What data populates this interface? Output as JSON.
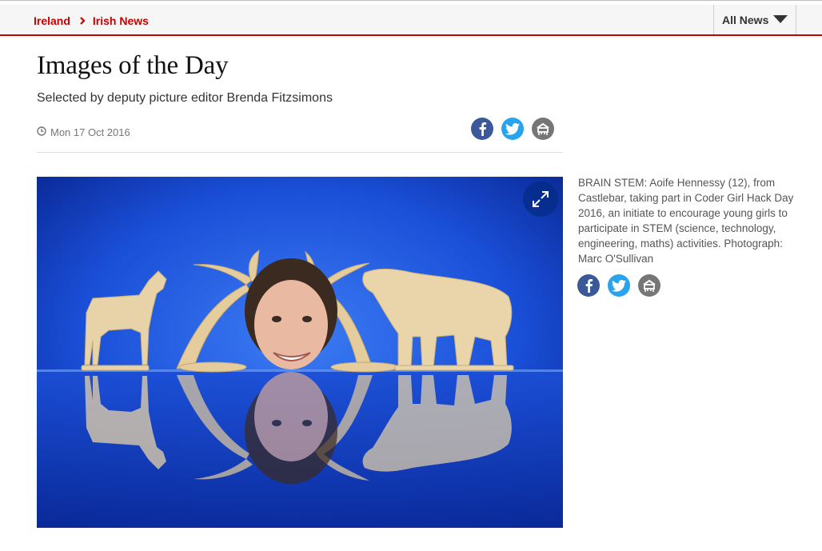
{
  "nav": {
    "breadcrumbs": [
      "Ireland",
      "Irish News"
    ],
    "all_news_label": "All News"
  },
  "article": {
    "title": "Images of the Day",
    "standfirst": "Selected by deputy picture editor Brenda Fitzsimons",
    "date": "Mon 17 Oct 2016"
  },
  "gallery": {
    "caption": "BRAIN STEM: Aoife Hennessy (12), from Castlebar, taking part in Coder Girl Hack Day 2016, an initiate to encourage young girls to participate in STEM (science, technology, engineering, maths) activities. Photograph: Marc O'Sullivan"
  },
  "share": {
    "icons": [
      "facebook-icon",
      "twitter-icon",
      "email-icon"
    ]
  },
  "colors": {
    "accent": "#c70000",
    "facebook": "#3b5998",
    "twitter": "#2aa3ef",
    "email": "#767676",
    "photo_background": "#1a4fd8"
  }
}
